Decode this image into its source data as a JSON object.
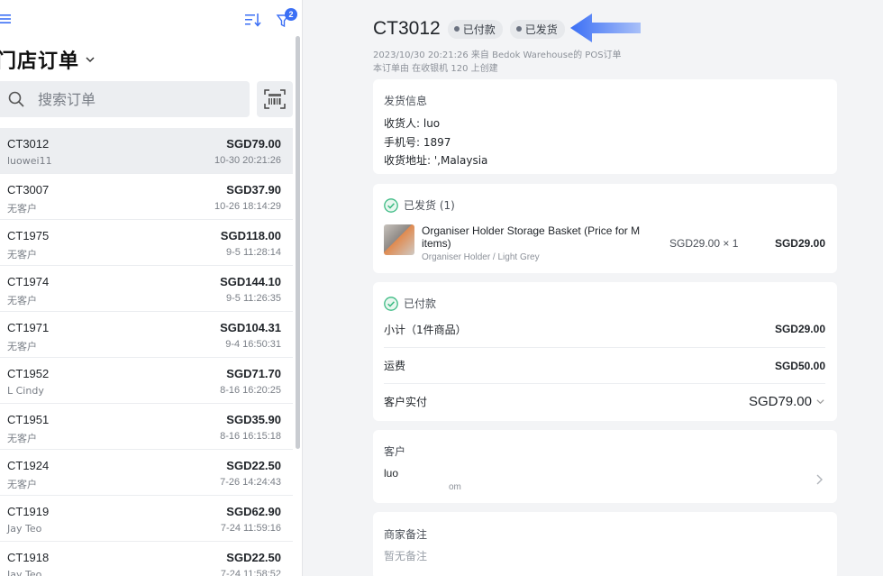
{
  "sidebar": {
    "filter_badge": "2",
    "store_title": "门店订单",
    "search_placeholder": "搜索订单",
    "orders": [
      {
        "id": "CT3012",
        "amount": "SGD79.00",
        "customer": "luowei11",
        "time": "10-30 20:21:26",
        "selected": true
      },
      {
        "id": "CT3007",
        "amount": "SGD37.90",
        "customer": "无客户",
        "time": "10-26 18:14:29"
      },
      {
        "id": "CT1975",
        "amount": "SGD118.00",
        "customer": "无客户",
        "time": "9-5 11:28:14"
      },
      {
        "id": "CT1974",
        "amount": "SGD144.10",
        "customer": "无客户",
        "time": "9-5 11:26:35"
      },
      {
        "id": "CT1971",
        "amount": "SGD104.31",
        "customer": "无客户",
        "time": "9-4 16:50:31"
      },
      {
        "id": "CT1952",
        "amount": "SGD71.70",
        "customer": "L Cindy",
        "time": "8-16 16:20:25"
      },
      {
        "id": "CT1951",
        "amount": "SGD35.90",
        "customer": "无客户",
        "time": "8-16 16:15:18"
      },
      {
        "id": "CT1924",
        "amount": "SGD22.50",
        "customer": "无客户",
        "time": "7-26 14:24:43"
      },
      {
        "id": "CT1919",
        "amount": "SGD62.90",
        "customer": "Jay Teo",
        "time": "7-24 11:59:16"
      },
      {
        "id": "CT1918",
        "amount": "SGD22.50",
        "customer": "Jay Teo",
        "time": "7-24 11:58:52"
      }
    ]
  },
  "detail": {
    "order_id": "CT3012",
    "status_paid": "已付款",
    "status_shipped": "已发货",
    "meta_line1": "2023/10/30 20:21:26 来自 Bedok Warehouse的 POS订单",
    "meta_line2": "本订单由       在收银机  120  上创建",
    "shipping": {
      "heading": "发货信息",
      "receiver": "收货人: luo",
      "phone": "手机号: 1897",
      "address": "收货地址:                             ',Malaysia"
    },
    "fulfilled": {
      "heading": "已发货 (1)",
      "product_name": "Organiser Holder Storage Basket (Price for M items)",
      "variant": "Organiser Holder  / Light Grey",
      "unit_qty": "SGD29.00 × 1",
      "line_total": "SGD29.00"
    },
    "payment": {
      "heading": "已付款",
      "subtotal_label": "小计（1件商品）",
      "subtotal": "SGD29.00",
      "shipping_label": "运费",
      "shipping": "SGD50.00",
      "paid_label": "客户实付",
      "paid": "SGD79.00"
    },
    "customer": {
      "heading": "客户",
      "name": "luo",
      "email": "om"
    },
    "notes": {
      "heading": "商家备注",
      "empty": "暂无备注"
    }
  },
  "colors": {
    "accent": "#3b6ff5",
    "check_green": "#3dbb84"
  }
}
